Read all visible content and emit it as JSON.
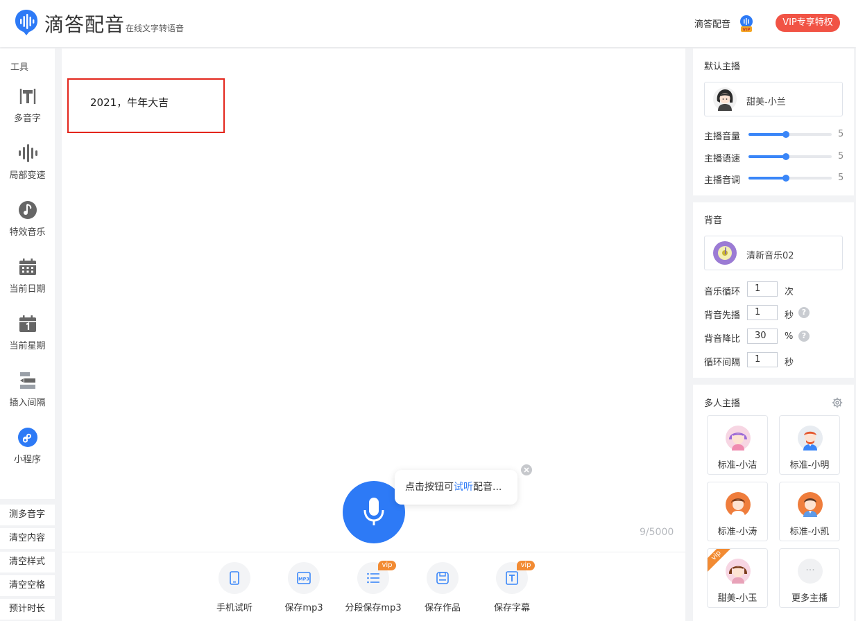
{
  "header": {
    "app_name": "滴答配音",
    "tagline": "在线文字转语音",
    "user_name": "滴答配音",
    "vip_button": "VIP专享特权",
    "vip_badge_text": "VIP"
  },
  "left_toolbar": {
    "section_label": "工具",
    "tools": [
      {
        "label": "多音字",
        "icon": "polyphone-icon"
      },
      {
        "label": "局部变速",
        "icon": "waveform-icon"
      },
      {
        "label": "特效音乐",
        "icon": "music-note-icon"
      },
      {
        "label": "当前日期",
        "icon": "calendar-grid-icon"
      },
      {
        "label": "当前星期",
        "icon": "calendar-day-icon"
      },
      {
        "label": "插入间隔",
        "icon": "insert-gap-icon"
      },
      {
        "label": "小程序",
        "icon": "mini-program-icon"
      }
    ],
    "actions": [
      "测多音字",
      "清空内容",
      "清空样式",
      "清空空格",
      "预计时长"
    ]
  },
  "editor": {
    "text": "2021，牛年大吉",
    "char_count": "9/5000",
    "hint_prefix": "点击按钮可",
    "hint_link": "试听",
    "hint_suffix": "配音...",
    "footer_buttons": [
      {
        "label": "手机试听",
        "icon": "phone-icon",
        "vip": false
      },
      {
        "label": "保存mp3",
        "icon": "mp3-file-icon",
        "vip": false
      },
      {
        "label": "分段保存mp3",
        "icon": "list-icon",
        "vip": true
      },
      {
        "label": "保存作品",
        "icon": "save-disk-icon",
        "vip": false
      },
      {
        "label": "保存字幕",
        "icon": "subtitle-text-icon",
        "vip": true
      }
    ],
    "vip_tag": "vip"
  },
  "anchor_panel": {
    "title": "默认主播",
    "anchor_name": "甜美-小兰",
    "sliders": [
      {
        "label": "主播音量",
        "value": 5,
        "fraction": 0.45
      },
      {
        "label": "主播语速",
        "value": 5,
        "fraction": 0.45
      },
      {
        "label": "主播音调",
        "value": 5,
        "fraction": 0.45
      }
    ]
  },
  "bgm_panel": {
    "title": "背音",
    "music_name": "清新音乐02",
    "settings": [
      {
        "label": "音乐循环",
        "value": "1",
        "unit": "次",
        "help": false
      },
      {
        "label": "背音先播",
        "value": "1",
        "unit": "秒",
        "help": true
      },
      {
        "label": "背音降比",
        "value": "30",
        "unit": "%",
        "help": true
      },
      {
        "label": "循环间隔",
        "value": "1",
        "unit": "秒",
        "help": false
      }
    ],
    "help_glyph": "?"
  },
  "multi_panel": {
    "title": "多人主播",
    "hosts": [
      {
        "name": "标准-小洁",
        "vip": false
      },
      {
        "name": "标准-小明",
        "vip": false
      },
      {
        "name": "标准-小涛",
        "vip": false
      },
      {
        "name": "标准-小凯",
        "vip": false
      },
      {
        "name": "甜美-小玉",
        "vip": true
      },
      {
        "name": "更多主播",
        "vip": false
      }
    ],
    "vip_corner": "vip",
    "more_glyph": "···"
  },
  "colors": {
    "accent_blue": "#2d7af6",
    "vip_red": "#f15345",
    "vip_orange": "#f28b33",
    "highlight_border": "#e3261c"
  }
}
